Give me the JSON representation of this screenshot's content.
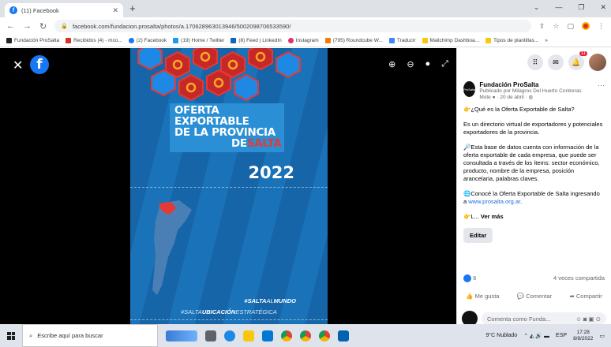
{
  "browser": {
    "tab_title": "(11) Facebook",
    "url": "facebook.com/fundacion.prosalta/photos/a.170628963013946/5002098706533590/",
    "bookmarks": [
      {
        "label": "Fundación ProSalta",
        "color": "#222222"
      },
      {
        "label": "Recibidos (4) - mco...",
        "color": "#d93025"
      },
      {
        "label": "(2) Facebook",
        "color": "#1877f2"
      },
      {
        "label": "(19) Home / Twitter",
        "color": "#1d9bf0"
      },
      {
        "label": "(8) Feed | LinkedIn",
        "color": "#0a66c2"
      },
      {
        "label": "Instagram",
        "color": "#e1306c"
      },
      {
        "label": "(795) Roundcube W...",
        "color": "#f57c00"
      },
      {
        "label": "Traducir",
        "color": "#4285f4"
      },
      {
        "label": "Mailchimp Dashboa...",
        "color": "#f9c80e"
      },
      {
        "label": "Tipos de plantillas...",
        "color": "#f9c80e"
      }
    ]
  },
  "poster": {
    "title_l1": "OFERTA",
    "title_l2": "EXPORTABLE",
    "title_l3": "DE LA PROVINCIA",
    "title_de": "DE",
    "title_salta": "SALTA",
    "year": "2022",
    "tag_prefix": "#SALTA",
    "tag_al": "AL",
    "tag_mundo": "MUNDO",
    "tag2_prefix": "#SALTA",
    "tag2_bold": "UBICACIÓN",
    "tag2_suffix": "ESTRATÉGICA"
  },
  "header": {
    "notifications": "11"
  },
  "post": {
    "page_name": "Fundación ProSalta",
    "published_by": "Publicado por Milagros Del Huerto Contreras Mote",
    "date": "· 20 de abril ·",
    "p1": "👉¿Qué es la Oferta Exportable de Salta?",
    "p2": "Es un directorio virtual de exportadores y potenciales exportadores de la provincia.",
    "p3": "🔎Esta base de datos cuenta con información de la oferta exportable de cada empresa, que puede ser consultada a través de los ítems: sector económico, producto, nombre de la empresa, posición arancelaria, palabras claves.",
    "p4a": "🌐Conocé la Oferta Exportable de Salta ingresando a",
    "p4link": "www.prosalta.org.ar",
    "p5": "👉L...",
    "ver_mas": "Ver más",
    "edit_label": "Editar",
    "likes": "6",
    "shares": "4 veces compartida",
    "like_label": "Me gusta",
    "comment_label": "Comentar",
    "share_label": "Compartir",
    "comment_placeholder": "Comenta como Funda..."
  },
  "taskbar": {
    "search_placeholder": "Escribe aquí para buscar",
    "weather": "9°C Nublado",
    "lang": "ESP",
    "time": "17:28",
    "date": "8/8/2022"
  }
}
